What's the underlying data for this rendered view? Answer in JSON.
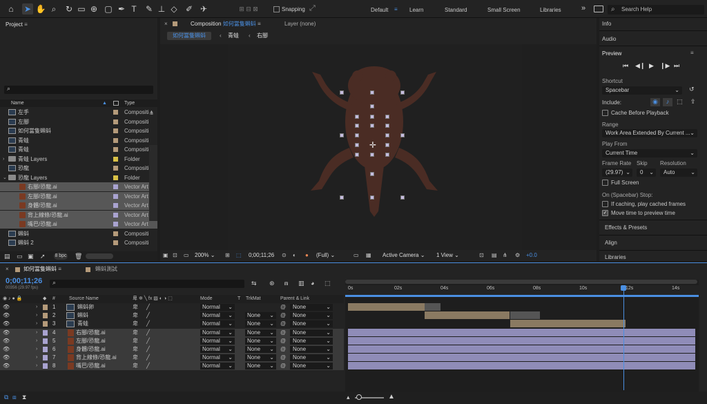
{
  "toolbar": {
    "snapping_label": "Snapping",
    "workspaces": [
      "Default",
      "Learn",
      "Standard",
      "Small Screen",
      "Libraries"
    ],
    "active_workspace": "Default",
    "search_placeholder": "Search Help",
    "more_glyph": "»"
  },
  "project": {
    "title": "Project",
    "columns": {
      "name": "Name",
      "type": "Type"
    },
    "items": [
      {
        "name": "左手",
        "type": "Compositi",
        "kind": "comp",
        "selected": false,
        "swatch": "#b49a7a"
      },
      {
        "name": "左腳",
        "type": "Compositi",
        "kind": "comp",
        "selected": false,
        "swatch": "#b49a7a"
      },
      {
        "name": "如何當隻蝌蚪",
        "type": "Compositi",
        "kind": "comp",
        "selected": false,
        "swatch": "#b49a7a"
      },
      {
        "name": "青蛙",
        "type": "Compositi",
        "kind": "comp",
        "selected": false,
        "swatch": "#b49a7a"
      },
      {
        "name": "青蛙",
        "type": "Compositi",
        "kind": "comp",
        "selected": false,
        "swatch": "#b49a7a"
      },
      {
        "name": "青蛙 Layers",
        "type": "Folder",
        "kind": "folder",
        "selected": false,
        "swatch": "#d8c046"
      },
      {
        "name": "恐龍",
        "type": "Compositi",
        "kind": "comp",
        "selected": false,
        "swatch": "#b49a7a"
      },
      {
        "name": "恐龍 Layers",
        "type": "Folder",
        "kind": "folder-open",
        "selected": false,
        "swatch": "#d8c046"
      },
      {
        "name": "右腳/恐龍.ai",
        "type": "Vector Art",
        "kind": "ai",
        "selected": true,
        "swatch": "#a9a3d0"
      },
      {
        "name": "左腳/恐龍.ai",
        "type": "Vector Art",
        "kind": "ai",
        "selected": true,
        "swatch": "#a9a3d0"
      },
      {
        "name": "身體/恐龍.ai",
        "type": "Vector Art",
        "kind": "ai",
        "selected": true,
        "swatch": "#a9a3d0"
      },
      {
        "name": "背上線條/恐龍.ai",
        "type": "Vector Art",
        "kind": "ai",
        "selected": true,
        "swatch": "#a9a3d0"
      },
      {
        "name": "嘴巴/恐龍.ai",
        "type": "Vector Art",
        "kind": "ai",
        "selected": true,
        "swatch": "#a9a3d0"
      },
      {
        "name": "蝌蚪",
        "type": "Compositi",
        "kind": "comp",
        "selected": false,
        "swatch": "#b49a7a"
      },
      {
        "name": "蝌蚪 2",
        "type": "Compositi",
        "kind": "comp",
        "selected": false,
        "swatch": "#b49a7a"
      }
    ],
    "bpc": "8 bpc"
  },
  "composition": {
    "tab_label": "Composition",
    "comp_name": "如何當隻蝌蚪",
    "layer_tab": "Layer (none)",
    "breadcrumbs": [
      "如何當隻蝌蚪",
      "青蛙",
      "右腳"
    ],
    "zoom": "200%",
    "timecode": "0;00;11;26",
    "resolution": "(Full)",
    "camera": "Active Camera",
    "views": "1 View",
    "exposure": "+0.0"
  },
  "right_panel": {
    "info": "Info",
    "audio": "Audio",
    "preview": "Preview",
    "shortcut_label": "Shortcut",
    "shortcut_value": "Spacebar",
    "include_label": "Include:",
    "cache_before": "Cache Before Playback",
    "range_label": "Range",
    "range_value": "Work Area Extended By Current ...",
    "play_from_label": "Play From",
    "play_from_value": "Current Time",
    "frame_rate_label": "Frame Rate",
    "skip_label": "Skip",
    "resolution_label": "Resolution",
    "frame_rate_value": "(29.97)",
    "skip_value": "0",
    "resolution_value": "Auto",
    "full_screen": "Full Screen",
    "stop_label": "On (Spacebar) Stop:",
    "if_caching": "If caching, play cached frames",
    "move_time": "Move time to preview time",
    "effects": "Effects & Presets",
    "align": "Align",
    "libraries": "Libraries"
  },
  "timeline": {
    "tab_active": "如何當隻蝌蚪",
    "tab_other": "蝌蚪測試",
    "timecode": "0;00;11;26",
    "fps": "00356 (29.97 fps)",
    "headers": {
      "num": "#",
      "source": "Source Name",
      "mode": "Mode",
      "t": "T",
      "trkmat": "TrkMat",
      "parent": "Parent & Link"
    },
    "ruler": [
      "0s",
      "02s",
      "04s",
      "06s",
      "08s",
      "10s",
      "12s",
      "14s"
    ],
    "playhead_seconds": 11.9,
    "layers": [
      {
        "num": "1",
        "name": "蝌蚪卵",
        "kind": "comp",
        "mode": "Normal",
        "trkmat": "",
        "parent": "None",
        "label": "#b49a7a",
        "start": 0,
        "end": 3.3,
        "tail": 4.0,
        "bar": "#8a7a62"
      },
      {
        "num": "2",
        "name": "蝌蚪",
        "kind": "comp",
        "mode": "Normal",
        "trkmat": "None",
        "parent": "None",
        "label": "#b49a7a",
        "start": 3.3,
        "end": 7.0,
        "tail": 8.3,
        "bar": "#8a7a62"
      },
      {
        "num": "3",
        "name": "青蛙",
        "kind": "comp",
        "mode": "Normal",
        "trkmat": "None",
        "parent": "None",
        "label": "#b49a7a",
        "start": 7.0,
        "end": 12.0,
        "tail": 12.0,
        "bar": "#8a7a62"
      },
      {
        "num": "4",
        "name": "右腳/恐龍.ai",
        "kind": "ai",
        "mode": "Normal",
        "trkmat": "None",
        "parent": "None",
        "label": "#a9a3d0",
        "start": 0,
        "end": 15.0,
        "tail": 15.0,
        "bar": "#8f8cb8"
      },
      {
        "num": "5",
        "name": "左腳/恐龍.ai",
        "kind": "ai",
        "mode": "Normal",
        "trkmat": "None",
        "parent": "None",
        "label": "#a9a3d0",
        "start": 0,
        "end": 15.0,
        "tail": 15.0,
        "bar": "#8f8cb8"
      },
      {
        "num": "6",
        "name": "身體/恐龍.ai",
        "kind": "ai",
        "mode": "Normal",
        "trkmat": "None",
        "parent": "None",
        "label": "#a9a3d0",
        "start": 0,
        "end": 15.0,
        "tail": 15.0,
        "bar": "#8f8cb8"
      },
      {
        "num": "7",
        "name": "背上線條/恐龍.ai",
        "kind": "ai",
        "mode": "Normal",
        "trkmat": "None",
        "parent": "None",
        "label": "#a9a3d0",
        "start": 0,
        "end": 15.0,
        "tail": 15.0,
        "bar": "#8f8cb8"
      },
      {
        "num": "8",
        "name": "嘴巴/恐龍.ai",
        "kind": "ai",
        "mode": "Normal",
        "trkmat": "None",
        "parent": "None",
        "label": "#a9a3d0",
        "start": 0,
        "end": 15.0,
        "tail": 15.0,
        "bar": "#8f8cb8"
      }
    ]
  },
  "colors": {
    "accent": "#4a8fe2",
    "frog": "#4a2c24"
  }
}
